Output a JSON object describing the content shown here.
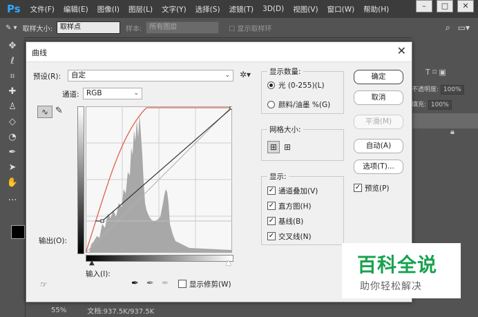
{
  "app": {
    "logo": "Ps",
    "menu": [
      "文件(F)",
      "编辑(E)",
      "图像(I)",
      "图层(L)",
      "文字(Y)",
      "选择(S)",
      "滤镜(T)",
      "3D(D)",
      "视图(V)",
      "窗口(W)",
      "帮助(H)"
    ],
    "window_controls": [
      "–",
      "□",
      "✕"
    ]
  },
  "options_bar": {
    "sample_size_label": "取样大小:",
    "sample_size_value": "取样点",
    "sample_label": "样本:",
    "sample_value": "所有图层",
    "show_ring_label": "显示取样环"
  },
  "right_panel": {
    "opacity_label": "不透明度:",
    "opacity_value": "100%",
    "fill_label": "填充:",
    "fill_value": "100%"
  },
  "status_bar": {
    "zoom": "55%",
    "doc": "文档:937.5K/937.5K"
  },
  "dialog": {
    "title": "曲线",
    "preset_label": "预设(R):",
    "preset_value": "自定",
    "channel_label": "通道:",
    "channel_value": "RGB",
    "output_label": "输出(O):",
    "input_label": "输入(I):",
    "show_clipping_label": "显示修剪(W)",
    "show_clipping_checked": false,
    "display_amount": {
      "title": "显示数量:",
      "options": [
        {
          "label": "光 (0-255)(L)",
          "selected": true
        },
        {
          "label": "颜料/油墨 %(G)",
          "selected": false
        }
      ]
    },
    "grid_size": {
      "title": "网格大小:"
    },
    "show": {
      "title": "显示:",
      "options": [
        {
          "label": "通道叠加(V)",
          "checked": true
        },
        {
          "label": "直方图(H)",
          "checked": true
        },
        {
          "label": "基线(B)",
          "checked": true
        },
        {
          "label": "交叉线(N)",
          "checked": true
        }
      ]
    },
    "buttons": {
      "ok": "确定",
      "cancel": "取消",
      "smooth": "平滑(M)",
      "auto": "自动(A)",
      "options": "选项(T)..."
    },
    "preview_label": "预览(P)",
    "preview_checked": true,
    "colors": {
      "curve_red": "#e0614f",
      "curve_black": "#333333"
    }
  },
  "watermark": {
    "main": "百科全说",
    "sub": "助你轻松解决"
  }
}
